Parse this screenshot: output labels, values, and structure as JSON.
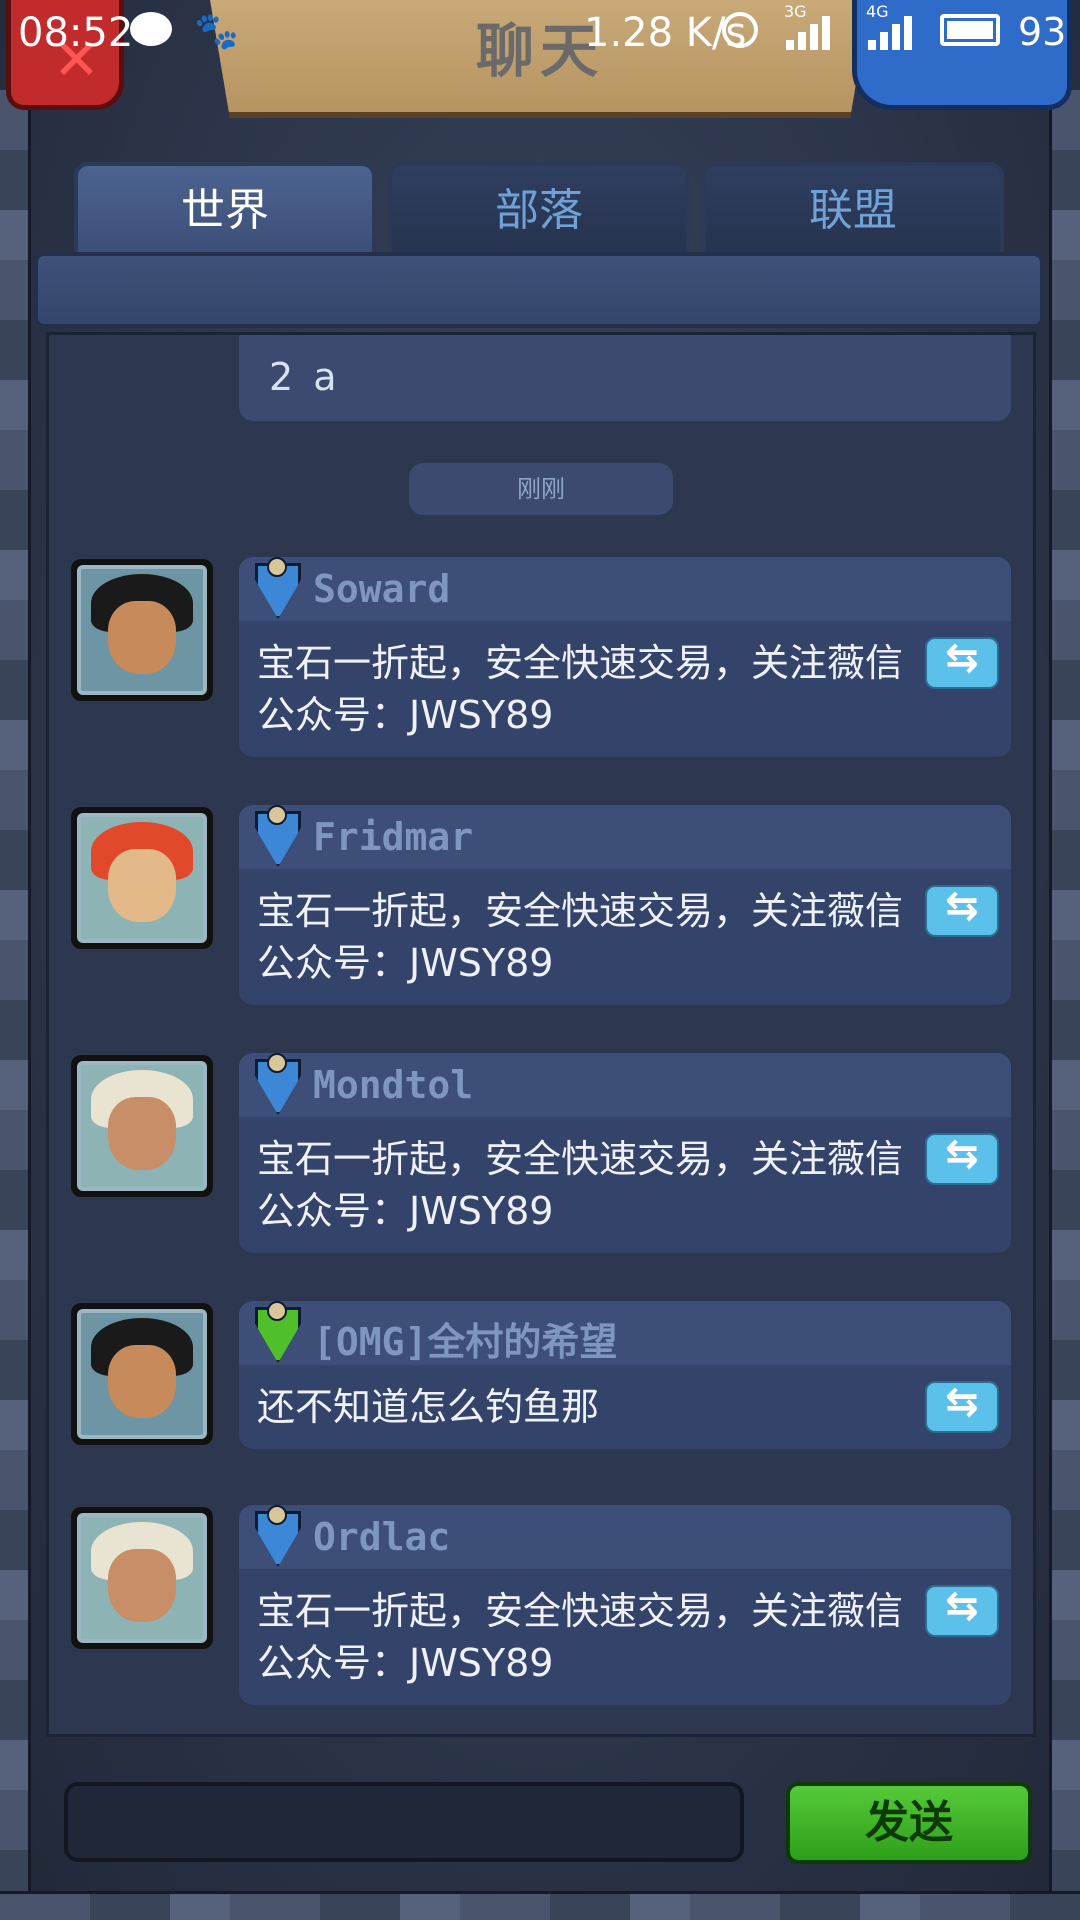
{
  "status_bar": {
    "time": "08:52",
    "net_speed": "1.28 K/s",
    "sim1": "3G",
    "sim2": "4G",
    "battery": "93"
  },
  "header": {
    "title": "聊天"
  },
  "tabs": [
    {
      "label": "世界",
      "active": true
    },
    {
      "label": "部落",
      "active": false
    },
    {
      "label": "联盟",
      "active": false
    }
  ],
  "previous_message": {
    "text": "2 a"
  },
  "time_label": "刚刚",
  "messages": [
    {
      "sender": "Soward",
      "badge": "blue-shield-icon",
      "avatar": "dark-haired-man-avatar",
      "text": "宝石一折起，安全快速交易，关注薇信公众号：JWSY89"
    },
    {
      "sender": "Fridmar",
      "badge": "blue-shield-icon",
      "avatar": "red-haired-woman-avatar",
      "text": "宝石一折起，安全快速交易，关注薇信公众号：JWSY89"
    },
    {
      "sender": "Mondtol",
      "badge": "blue-shield-icon",
      "avatar": "white-haired-woman-avatar",
      "text": "宝石一折起，安全快速交易，关注薇信公众号：JWSY89"
    },
    {
      "sender": "[OMG]全村的希望",
      "badge": "green-shield-icon",
      "avatar": "dark-haired-man-avatar",
      "text": "还不知道怎么钓鱼那"
    },
    {
      "sender": "Ordlac",
      "badge": "blue-shield-icon",
      "avatar": "white-haired-woman-avatar",
      "text": "宝石一折起，安全快速交易，关注薇信公众号：JWSY89"
    }
  ],
  "input": {
    "value": ""
  },
  "send_button": {
    "label": "发送"
  },
  "colors": {
    "tab_active_text": "#ffffff",
    "tab_inactive_text": "#6fa2d6",
    "send_button": "#3fb326",
    "close_button": "#c22b2b",
    "menu_button": "#2f6bc8"
  }
}
